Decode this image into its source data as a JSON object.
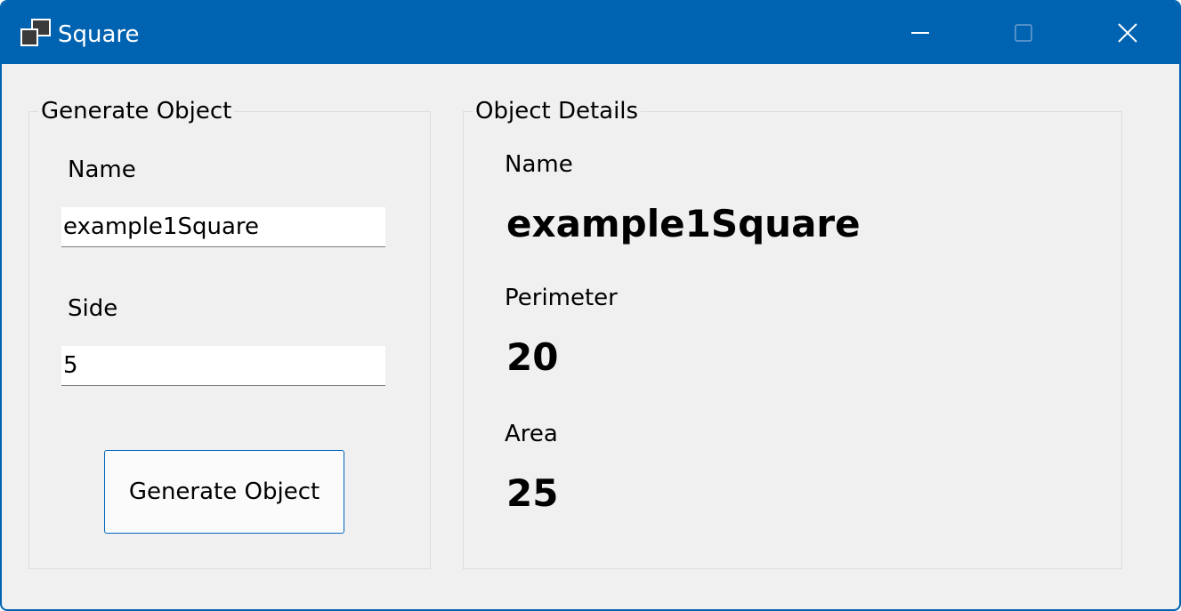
{
  "window": {
    "title": "Square",
    "accent_color": "#0063b1",
    "icons": {
      "app": "window-stack-icon",
      "minimize": "minimize-icon",
      "maximize": "maximize-icon",
      "close": "close-icon"
    }
  },
  "generate_group": {
    "title": "Generate Object",
    "name_label": "Name",
    "name_value": "example1Square",
    "side_label": "Side",
    "side_value": "5",
    "button_label": "Generate Object"
  },
  "details_group": {
    "title": "Object Details",
    "name_label": "Name",
    "name_value": "example1Square",
    "perimeter_label": "Perimeter",
    "perimeter_value": "20",
    "area_label": "Area",
    "area_value": "25"
  }
}
